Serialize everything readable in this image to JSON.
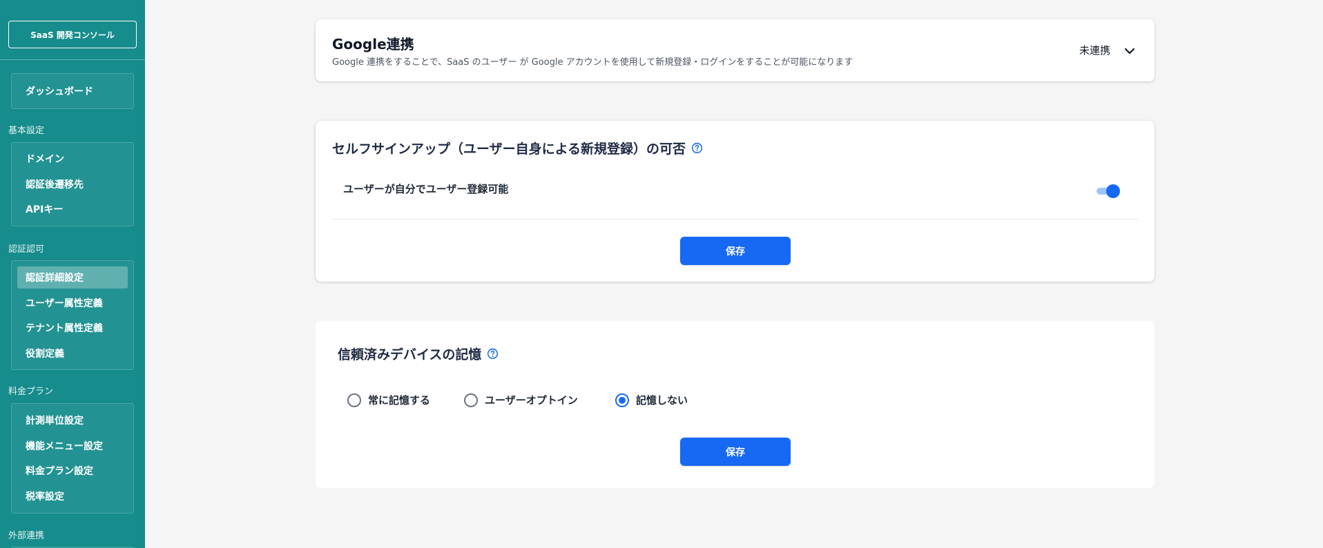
{
  "sidebar": {
    "console_button": "SaaS 開発コンソール",
    "dashboard": "ダッシュボード",
    "sections": [
      {
        "label": "基本設定",
        "items": [
          "ドメイン",
          "認証後遷移先",
          "APIキー"
        ]
      },
      {
        "label": "認証認可",
        "items": [
          "認証詳細設定",
          "ユーザー属性定義",
          "テナント属性定義",
          "役割定義"
        ],
        "active_index": 0
      },
      {
        "label": "料金プラン",
        "items": [
          "計測単位設定",
          "機能メニュー設定",
          "料金プラン設定",
          "税率設定"
        ]
      },
      {
        "label": "外部連携",
        "items": []
      }
    ]
  },
  "google": {
    "title": "Google連携",
    "description": "Google 連携をすることで、SaaS のユーザー が Google アカウントを使用して新規登録・ログインをすることが可能になります",
    "status": "未連携",
    "expand_icon": "chevron-down-icon"
  },
  "signup": {
    "title": "セルフサインアップ（ユーザー自身による新規登録）の可否",
    "help_icon": "question-circle-icon",
    "toggle_label": "ユーザーが自分でユーザー登録可能",
    "toggle_on": true,
    "save_label": "保存"
  },
  "trusted_device": {
    "title": "信頼済みデバイスの記憶",
    "help_icon": "question-circle-icon",
    "options": [
      "常に記憶する",
      "ユーザーオプトイン",
      "記憶しない"
    ],
    "selected_index": 2,
    "save_label": "保存"
  },
  "colors": {
    "sidebar_bg": "#168c8c",
    "primary": "#1769f3",
    "page_bg": "#f5f5f5"
  }
}
